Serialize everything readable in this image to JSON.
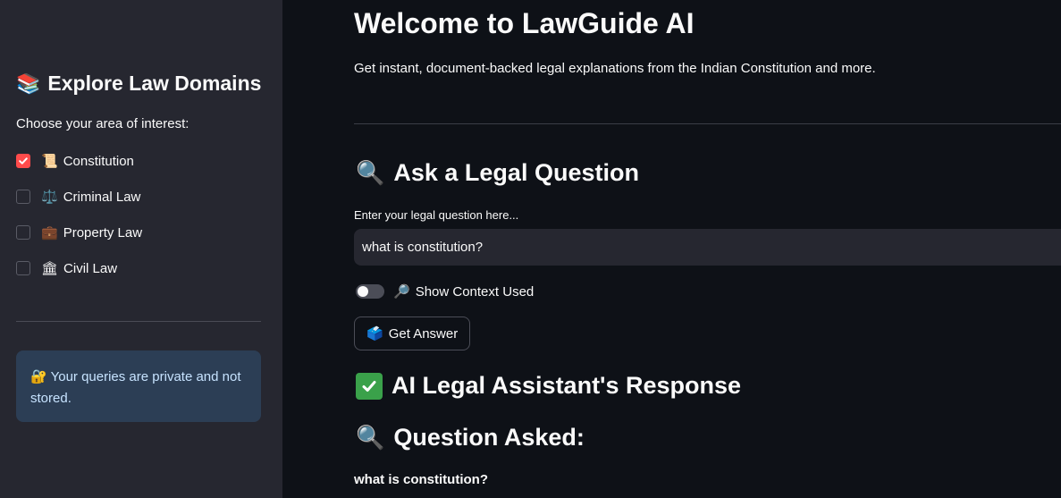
{
  "sidebar": {
    "title_icon": "books-icon",
    "title_icon_glyph": "📚",
    "title": "Explore Law Domains",
    "subtitle": "Choose your area of interest:",
    "domains": [
      {
        "label": "Constitution",
        "icon": "scroll-icon",
        "glyph": "📜",
        "checked": true
      },
      {
        "label": "Criminal Law",
        "icon": "scales-icon",
        "glyph": "⚖️",
        "checked": false
      },
      {
        "label": "Property Law",
        "icon": "briefcase-icon",
        "glyph": "💼",
        "checked": false
      },
      {
        "label": "Civil Law",
        "icon": "classical-building-icon",
        "glyph": "🏛",
        "checked": false
      }
    ],
    "info": {
      "icon": "lock-with-key-icon",
      "glyph": "🔐",
      "text": "Your queries are private and not stored."
    }
  },
  "main": {
    "title": "Welcome to LawGuide AI",
    "subtitle": "Get instant, document-backed legal explanations from the Indian Constitution and more.",
    "ask_section": {
      "icon": "magnifying-glass-icon",
      "glyph": "🔍",
      "heading": "Ask a Legal Question",
      "input_label": "Enter your legal question here...",
      "input_value": "what is constitution?"
    },
    "toggle": {
      "icon": "magnifying-glass-right-icon",
      "glyph": "🔎",
      "label": "Show Context Used",
      "on": false
    },
    "button": {
      "icon": "ballot-box-icon",
      "glyph": "🗳️",
      "label": "Get Answer"
    },
    "response_section": {
      "icon": "check-mark-icon",
      "heading": "AI Legal Assistant's Response"
    },
    "question_section": {
      "icon": "magnifying-glass-icon",
      "glyph": "🔍",
      "heading": "Question Asked:",
      "question": "what is constitution?"
    }
  },
  "colors": {
    "background": "#0e1117",
    "sidebar": "#262730",
    "accent": "#ff4b4b",
    "info_bg": "#2c3e55",
    "info_text": "#c7e3ff",
    "check_green": "#3aa14a"
  }
}
